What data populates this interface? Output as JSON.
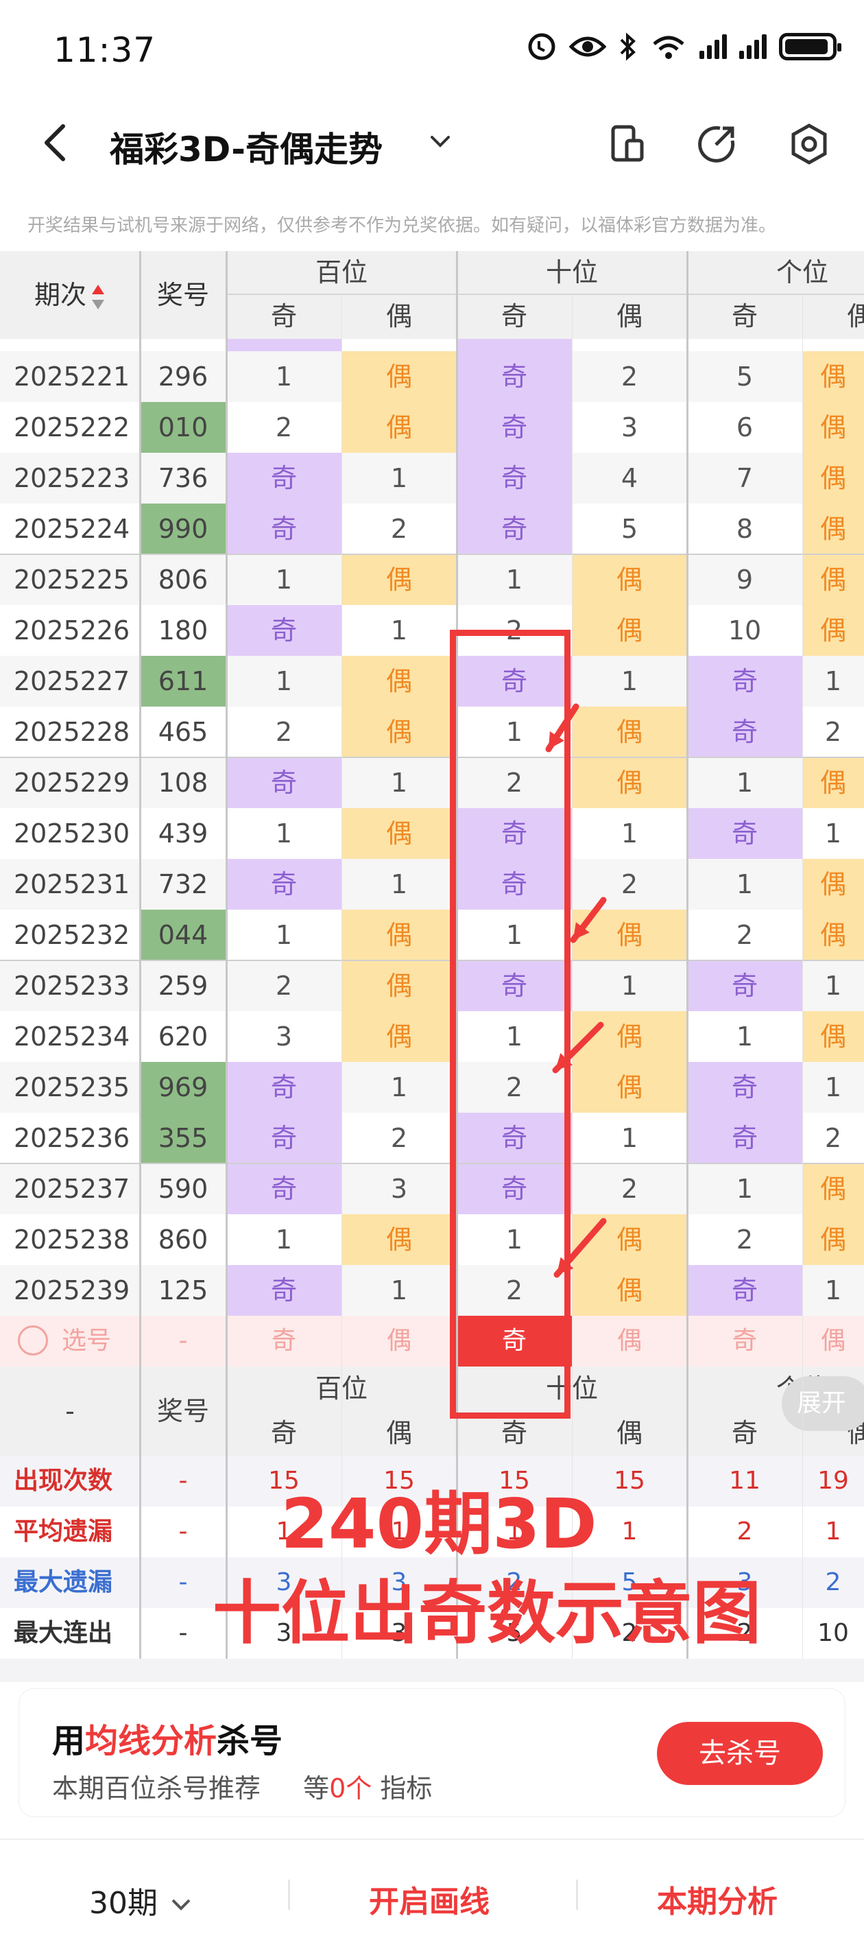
{
  "status_bar": {
    "time": "11:37"
  },
  "nav": {
    "title": "福彩3D-奇偶走势",
    "notice": "开奖结果与试机号来源于网络，仅供参考不作为兑奖依据。如有疑问，以福体彩官方数据为准。"
  },
  "table_header": {
    "issue": "期次",
    "draw": "奖号",
    "groups": [
      "百位",
      "十位",
      "个位"
    ],
    "odd": "奇",
    "even": "偶"
  },
  "rows": [
    {
      "issue": "2025221",
      "draw": "296",
      "green": false,
      "cells": [
        "1",
        "偶",
        "奇",
        "2",
        "5",
        "偶"
      ]
    },
    {
      "issue": "2025222",
      "draw": "010",
      "green": true,
      "cells": [
        "2",
        "偶",
        "奇",
        "3",
        "6",
        "偶"
      ]
    },
    {
      "issue": "2025223",
      "draw": "736",
      "green": false,
      "cells": [
        "奇",
        "1",
        "奇",
        "4",
        "7",
        "偶"
      ]
    },
    {
      "issue": "2025224",
      "draw": "990",
      "green": true,
      "cells": [
        "奇",
        "2",
        "奇",
        "5",
        "8",
        "偶"
      ]
    },
    {
      "issue": "2025225",
      "draw": "806",
      "green": false,
      "cells": [
        "1",
        "偶",
        "1",
        "偶",
        "9",
        "偶"
      ]
    },
    {
      "issue": "2025226",
      "draw": "180",
      "green": false,
      "cells": [
        "奇",
        "1",
        "2",
        "偶",
        "10",
        "偶"
      ]
    },
    {
      "issue": "2025227",
      "draw": "611",
      "green": true,
      "cells": [
        "1",
        "偶",
        "奇",
        "1",
        "奇",
        "1"
      ]
    },
    {
      "issue": "2025228",
      "draw": "465",
      "green": false,
      "cells": [
        "2",
        "偶",
        "1",
        "偶",
        "奇",
        "2"
      ]
    },
    {
      "issue": "2025229",
      "draw": "108",
      "green": false,
      "cells": [
        "奇",
        "1",
        "2",
        "偶",
        "1",
        "偶"
      ]
    },
    {
      "issue": "2025230",
      "draw": "439",
      "green": false,
      "cells": [
        "1",
        "偶",
        "奇",
        "1",
        "奇",
        "1"
      ]
    },
    {
      "issue": "2025231",
      "draw": "732",
      "green": false,
      "cells": [
        "奇",
        "1",
        "奇",
        "2",
        "1",
        "偶"
      ]
    },
    {
      "issue": "2025232",
      "draw": "044",
      "green": true,
      "cells": [
        "1",
        "偶",
        "1",
        "偶",
        "2",
        "偶"
      ]
    },
    {
      "issue": "2025233",
      "draw": "259",
      "green": false,
      "cells": [
        "2",
        "偶",
        "奇",
        "1",
        "奇",
        "1"
      ]
    },
    {
      "issue": "2025234",
      "draw": "620",
      "green": false,
      "cells": [
        "3",
        "偶",
        "1",
        "偶",
        "1",
        "偶"
      ]
    },
    {
      "issue": "2025235",
      "draw": "969",
      "green": true,
      "cells": [
        "奇",
        "1",
        "2",
        "偶",
        "奇",
        "1"
      ]
    },
    {
      "issue": "2025236",
      "draw": "355",
      "green": true,
      "cells": [
        "奇",
        "2",
        "奇",
        "1",
        "奇",
        "2"
      ]
    },
    {
      "issue": "2025237",
      "draw": "590",
      "green": false,
      "cells": [
        "奇",
        "3",
        "奇",
        "2",
        "1",
        "偶"
      ]
    },
    {
      "issue": "2025238",
      "draw": "860",
      "green": false,
      "cells": [
        "1",
        "偶",
        "1",
        "偶",
        "2",
        "偶"
      ]
    },
    {
      "issue": "2025239",
      "draw": "125",
      "green": false,
      "cells": [
        "奇",
        "1",
        "2",
        "偶",
        "奇",
        "1"
      ]
    }
  ],
  "select_row": {
    "label": "选号",
    "dash": "-",
    "cells": [
      "奇",
      "偶",
      "奇",
      "偶",
      "奇",
      "偶"
    ]
  },
  "stats_header": {
    "dash": "-",
    "draw": "奖号",
    "expand": "展开"
  },
  "stats": [
    {
      "label": "出现次数",
      "color": "#d9302c",
      "dash": "-",
      "values": [
        "15",
        "15",
        "15",
        "15",
        "11",
        "19"
      ]
    },
    {
      "label": "平均遗漏",
      "color": "#d9302c",
      "dash": "-",
      "values": [
        "1",
        "1",
        "1",
        "1",
        "2",
        "1"
      ]
    },
    {
      "label": "最大遗漏",
      "color": "#3b6fd0",
      "dash": "-",
      "values": [
        "3",
        "3",
        "2",
        "5",
        "3",
        "2"
      ]
    },
    {
      "label": "最大连出",
      "color": "#333333",
      "dash": "-",
      "values": [
        "3",
        "3",
        "5",
        "2",
        "2",
        "10"
      ]
    }
  ],
  "overlay": {
    "line1": "240期3D",
    "line2": "十位出奇数示意图"
  },
  "promo": {
    "pre": "用",
    "highlight": "均线分析",
    "post": "杀号",
    "sub_left": "本期百位杀号推荐",
    "sub_mid_pre": "等",
    "sub_mid_num": "0个",
    "sub_mid_post": "指标",
    "button": "去杀号"
  },
  "footer": {
    "period": "30期",
    "draw_line": "开启画线",
    "analysis": "本期分析"
  },
  "colors": {
    "accent_red": "#ef3a3a",
    "odd_bg": "#e1ccf9",
    "even_bg": "#fde3a6",
    "green": "#8fbd87"
  }
}
